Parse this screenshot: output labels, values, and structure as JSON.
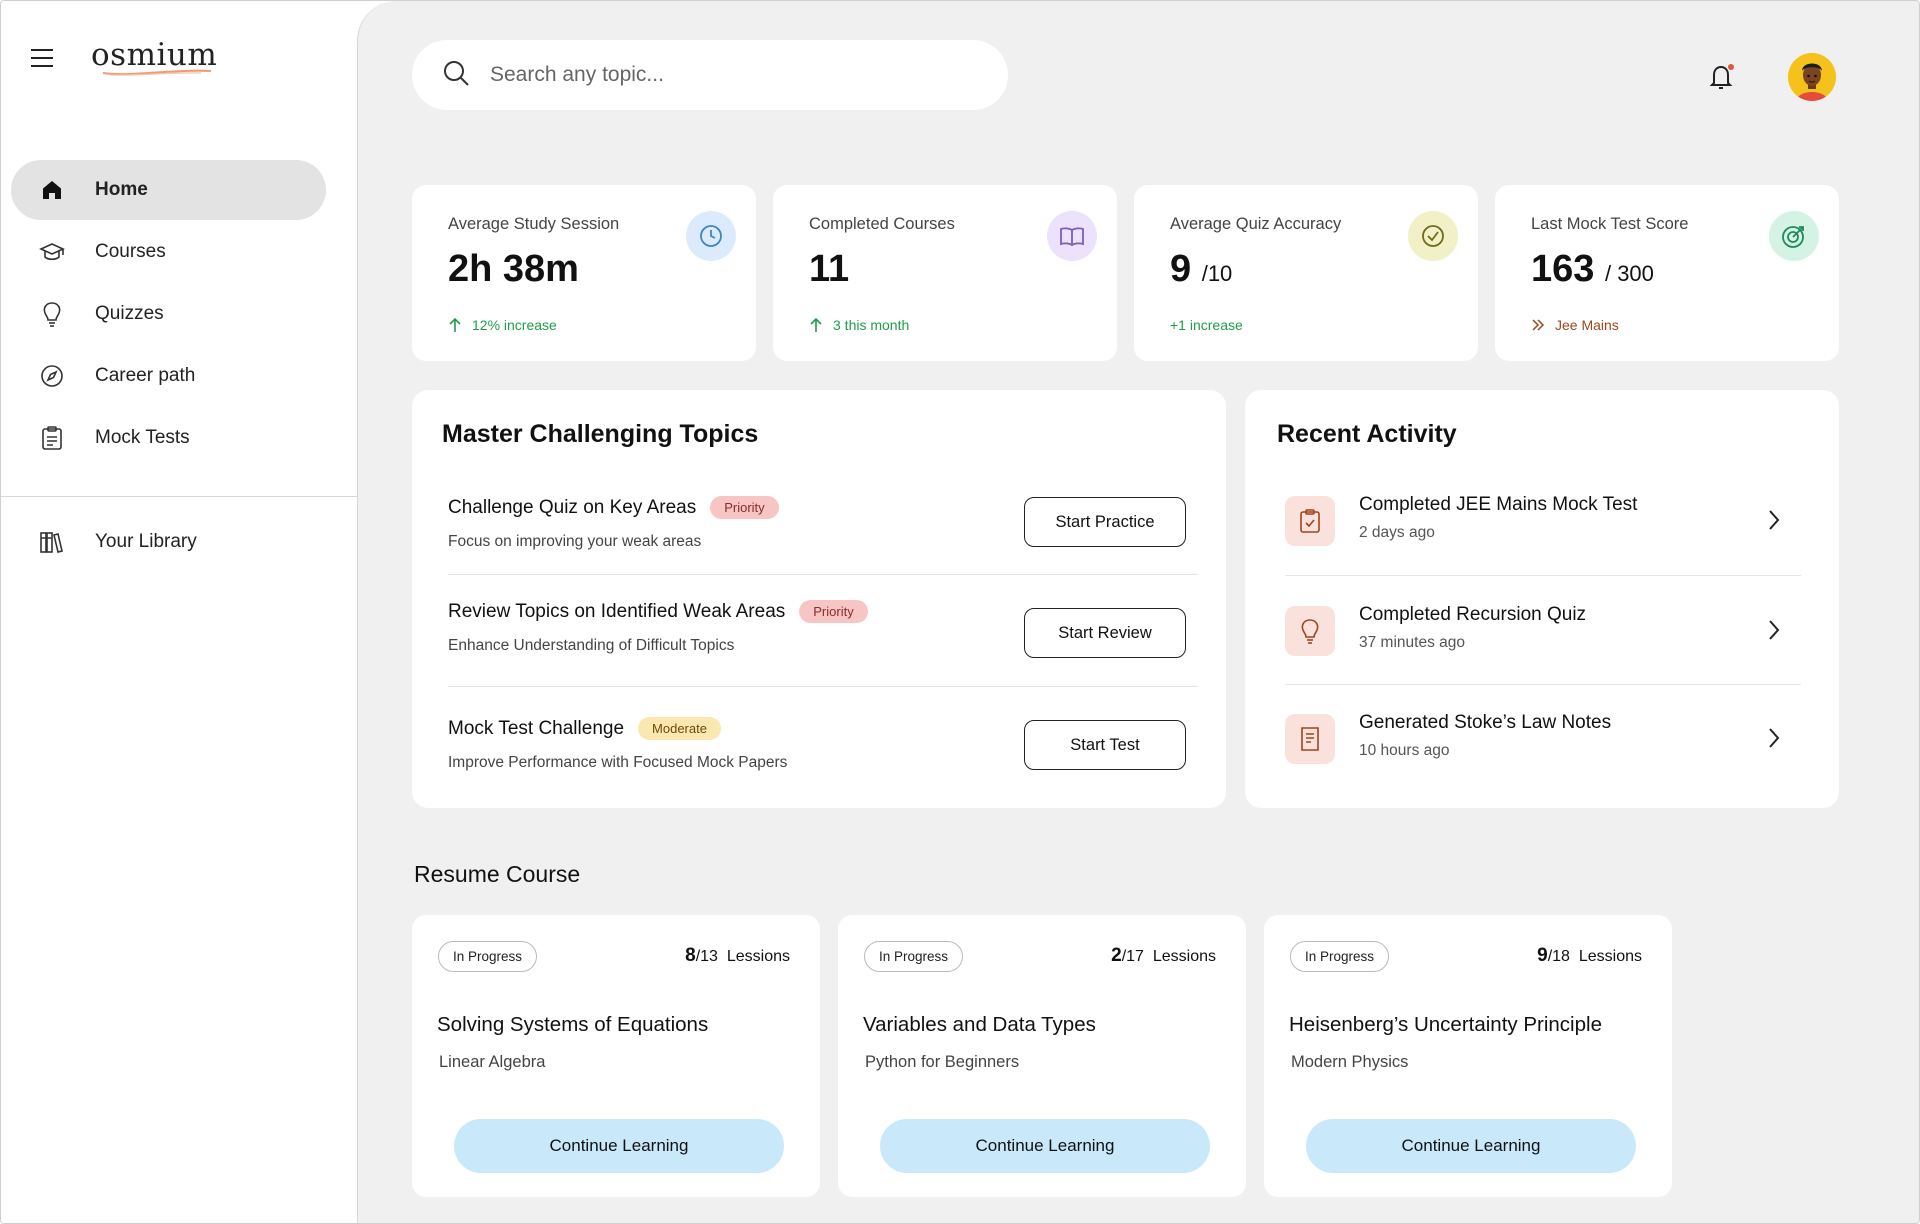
{
  "app": {
    "logo": "osmium"
  },
  "sidebar": {
    "items": [
      {
        "label": "Home",
        "icon": "home-icon",
        "active": true
      },
      {
        "label": "Courses",
        "icon": "graduation-cap-icon"
      },
      {
        "label": "Quizzes",
        "icon": "lightbulb-icon"
      },
      {
        "label": "Career path",
        "icon": "compass-icon"
      },
      {
        "label": "Mock Tests",
        "icon": "clipboard-icon"
      }
    ],
    "library": {
      "label": "Your Library",
      "icon": "library-icon"
    }
  },
  "header": {
    "search_placeholder": "Search any topic...",
    "notification_dot_color": "#e4572e"
  },
  "stats": [
    {
      "label": "Average Study Session",
      "value": "2h 38m",
      "sub": "",
      "foot": "12% increase",
      "icon": "clock-icon",
      "icon_bg": "#dcebfb"
    },
    {
      "label": "Completed Courses",
      "value": "11",
      "sub": "",
      "foot": "3 this month",
      "icon": "book-icon",
      "icon_bg": "#ece2fb"
    },
    {
      "label": "Average Quiz Accuracy",
      "value": "9",
      "sub": "/10",
      "foot": "+1 increase",
      "icon": "check-circle-icon",
      "icon_bg": "#f2f0c6"
    },
    {
      "label": "Last Mock Test Score",
      "value": "163",
      "sub": "/ 300",
      "foot": "Jee Mains",
      "icon": "target-icon",
      "icon_bg": "#d5f3e4"
    }
  ],
  "topics": {
    "title": "Master Challenging Topics",
    "items": [
      {
        "title": "Challenge Quiz on Key Areas",
        "tag": "Priority",
        "desc": "Focus on improving your weak areas",
        "button": "Start Practice"
      },
      {
        "title": "Review Topics on Identified Weak Areas",
        "tag": "Priority",
        "desc": "Enhance Understanding of Difficult Topics",
        "button": "Start Review"
      },
      {
        "title": "Mock Test Challenge",
        "tag": "Moderate",
        "desc": "Improve Performance with Focused Mock Papers",
        "button": "Start Test"
      }
    ]
  },
  "activity": {
    "title": "Recent Activity",
    "items": [
      {
        "title": "Completed JEE Mains Mock Test",
        "time": "2 days ago",
        "icon": "clipboard-check-icon"
      },
      {
        "title": "Completed Recursion Quiz",
        "time": "37 minutes ago",
        "icon": "lightbulb-icon"
      },
      {
        "title": "Generated Stoke’s Law Notes",
        "time": "10 hours ago",
        "icon": "notes-icon"
      }
    ]
  },
  "resume": {
    "title": "Resume Course",
    "courses": [
      {
        "status": "In Progress",
        "done": "8",
        "total": "/13",
        "lessons_label": "Lessions",
        "name": "Solving Systems of Equations",
        "category": "Linear Algebra",
        "button": "Continue Learning"
      },
      {
        "status": "In Progress",
        "done": "2",
        "total": "/17",
        "lessons_label": "Lessions",
        "name": "Variables and Data Types",
        "category": "Python for Beginners",
        "button": "Continue Learning"
      },
      {
        "status": "In Progress",
        "done": "9",
        "total": "/18",
        "lessons_label": "Lessions",
        "name": "Heisenberg’s Uncertainty Principle",
        "category": "Modern  Physics",
        "button": "Continue Learning"
      }
    ]
  }
}
